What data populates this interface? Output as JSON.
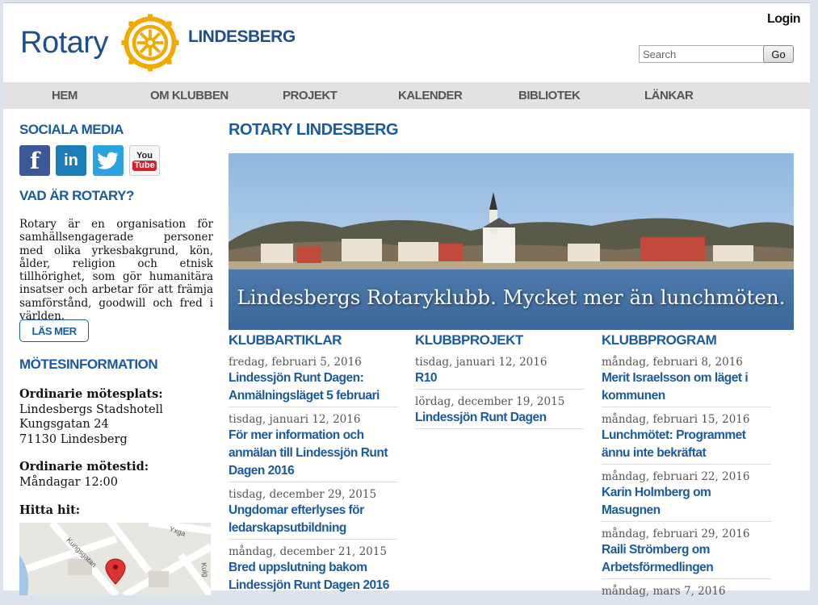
{
  "header": {
    "logo_text": "Rotary",
    "club_name": "LINDESBERG",
    "login": "Login",
    "search_placeholder": "Search",
    "go": "Go"
  },
  "nav": [
    "HEM",
    "OM KLUBBEN",
    "PROJEKT",
    "KALENDER",
    "BIBLIOTEK",
    "LÄNKAR"
  ],
  "sidebar": {
    "social_heading": "SOCIALA MEDIA",
    "social_icons": [
      "facebook-icon",
      "linkedin-icon",
      "twitter-icon",
      "youtube-icon"
    ],
    "about_heading": "VAD ÄR ROTARY?",
    "about_text": "Rotary är en organisation för samhällsengagerade personer med olika yrkesbakgrund, kön, ålder, religion och etnisk tillhörighet, som gör humanitära insatser och arbetar för att främja samförstånd, goodwill och fred i världen.",
    "read_more": "LÄS MER",
    "meeting_heading": "MÖTESINFORMATION",
    "place_label": "Ordinarie mötesplats:",
    "place_lines": [
      "Lindesbergs Stadshotell",
      "Kungsgatan 24",
      "71130 Lindesberg"
    ],
    "time_label": "Ordinarie mötestid:",
    "time_value": "Måndagar 12:00",
    "directions_label": "Hitta hit:",
    "map_streets": [
      "Kungsgatan",
      "Yxga",
      "Kulg"
    ]
  },
  "main": {
    "heading": "ROTARY LINDESBERG",
    "hero_caption": "Lindesbergs Rotaryklubb. Mycket mer än lunchmöten.",
    "columns": [
      {
        "heading": "KLUBBARTIKLAR",
        "items": [
          {
            "date": "fredag, februari 5, 2016",
            "title": "Lindessjön Runt Dagen: Anmälningsläget 5 februari"
          },
          {
            "date": "tisdag, januari 12, 2016",
            "title": "För mer information och anmälan till Lindessjön Runt Dagen 2016"
          },
          {
            "date": "tisdag, december 29, 2015",
            "title": "Ungdomar efterlyses för ledarskapsutbildning"
          },
          {
            "date": "måndag, december 21, 2015",
            "title": "Bred uppslutning bakom Lindessjön Runt Dagen 2016"
          }
        ]
      },
      {
        "heading": "KLUBBPROJEKT",
        "items": [
          {
            "date": "tisdag, januari 12, 2016",
            "title": "R10"
          },
          {
            "date": "lördag, december 19, 2015",
            "title": "Lindessjön Runt Dagen"
          }
        ]
      },
      {
        "heading": "KLUBBPROGRAM",
        "items": [
          {
            "date": "måndag, februari 8, 2016",
            "title": "Merit Israelsson om läget i kommunen"
          },
          {
            "date": "måndag, februari 15, 2016",
            "title": "Lunchmötet: Programmet ännu inte bekräftat"
          },
          {
            "date": "måndag, februari 22, 2016",
            "title": "Karin Holmberg om Masugnen"
          },
          {
            "date": "måndag, februari 29, 2016",
            "title": "Raili Strömberg om Arbetsförmedlingen"
          },
          {
            "date": "måndag, mars 7, 2016",
            "title": ""
          }
        ]
      }
    ]
  }
}
